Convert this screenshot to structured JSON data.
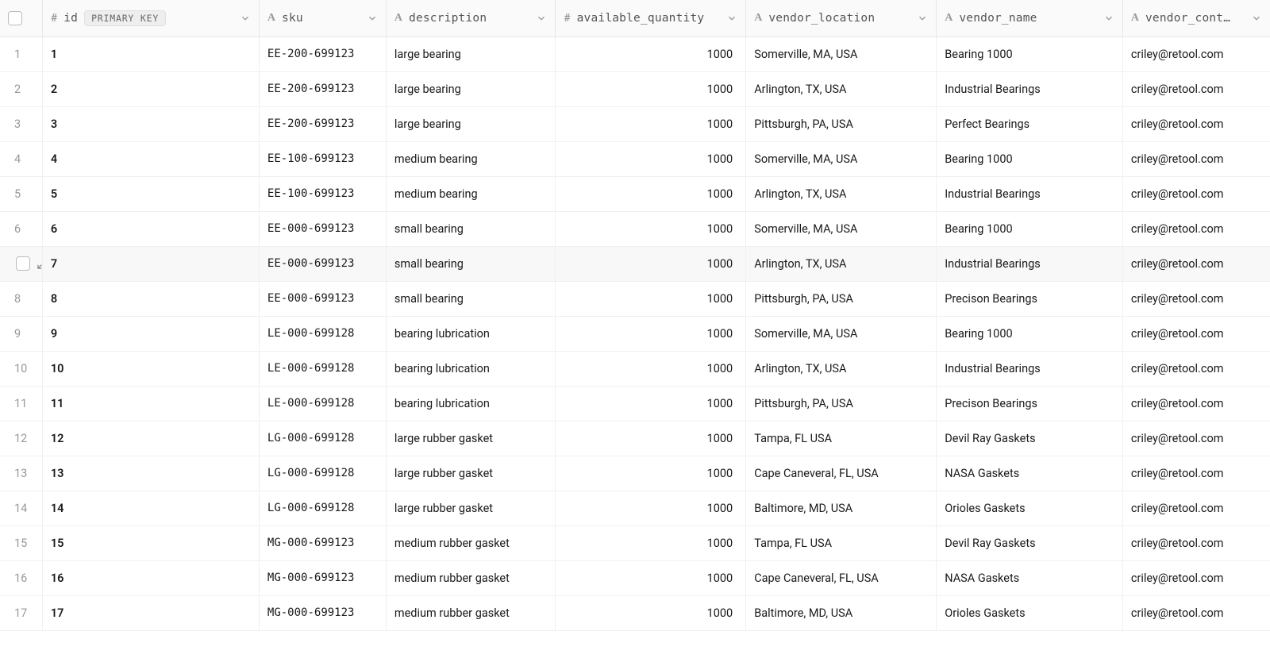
{
  "columns": {
    "id": {
      "label": "id",
      "badge": "PRIMARY KEY",
      "type": "number"
    },
    "sku": {
      "label": "sku",
      "type": "text"
    },
    "description": {
      "label": "description",
      "type": "text"
    },
    "available_quantity": {
      "label": "available_quantity",
      "type": "number"
    },
    "vendor_location": {
      "label": "vendor_location",
      "type": "text"
    },
    "vendor_name": {
      "label": "vendor_name",
      "type": "text"
    },
    "vendor_contact": {
      "label": "vendor_cont…",
      "type": "text"
    }
  },
  "hovered_row_index": 6,
  "rows": [
    {
      "rownum": "1",
      "id": "1",
      "sku": "EE-200-699123",
      "description": "large bearing",
      "available_quantity": "1000",
      "vendor_location": "Somerville, MA, USA",
      "vendor_name": "Bearing 1000",
      "vendor_contact": "criley@retool.com"
    },
    {
      "rownum": "2",
      "id": "2",
      "sku": "EE-200-699123",
      "description": "large bearing",
      "available_quantity": "1000",
      "vendor_location": "Arlington, TX, USA",
      "vendor_name": "Industrial Bearings",
      "vendor_contact": "criley@retool.com"
    },
    {
      "rownum": "3",
      "id": "3",
      "sku": "EE-200-699123",
      "description": "large bearing",
      "available_quantity": "1000",
      "vendor_location": "Pittsburgh, PA, USA",
      "vendor_name": "Perfect Bearings",
      "vendor_contact": "criley@retool.com"
    },
    {
      "rownum": "4",
      "id": "4",
      "sku": "EE-100-699123",
      "description": "medium bearing",
      "available_quantity": "1000",
      "vendor_location": "Somerville, MA, USA",
      "vendor_name": "Bearing 1000",
      "vendor_contact": "criley@retool.com"
    },
    {
      "rownum": "5",
      "id": "5",
      "sku": "EE-100-699123",
      "description": "medium bearing",
      "available_quantity": "1000",
      "vendor_location": "Arlington, TX, USA",
      "vendor_name": "Industrial Bearings",
      "vendor_contact": "criley@retool.com"
    },
    {
      "rownum": "6",
      "id": "6",
      "sku": "EE-000-699123",
      "description": "small bearing",
      "available_quantity": "1000",
      "vendor_location": "Somerville, MA, USA",
      "vendor_name": "Bearing 1000",
      "vendor_contact": "criley@retool.com"
    },
    {
      "rownum": "7",
      "id": "7",
      "sku": "EE-000-699123",
      "description": "small bearing",
      "available_quantity": "1000",
      "vendor_location": "Arlington, TX, USA",
      "vendor_name": "Industrial Bearings",
      "vendor_contact": "criley@retool.com"
    },
    {
      "rownum": "8",
      "id": "8",
      "sku": "EE-000-699123",
      "description": "small bearing",
      "available_quantity": "1000",
      "vendor_location": "Pittsburgh, PA, USA",
      "vendor_name": "Precison Bearings",
      "vendor_contact": "criley@retool.com"
    },
    {
      "rownum": "9",
      "id": "9",
      "sku": "LE-000-699128",
      "description": "bearing lubrication",
      "available_quantity": "1000",
      "vendor_location": "Somerville, MA, USA",
      "vendor_name": "Bearing 1000",
      "vendor_contact": "criley@retool.com"
    },
    {
      "rownum": "10",
      "id": "10",
      "sku": "LE-000-699128",
      "description": "bearing lubrication",
      "available_quantity": "1000",
      "vendor_location": "Arlington, TX, USA",
      "vendor_name": "Industrial Bearings",
      "vendor_contact": "criley@retool.com"
    },
    {
      "rownum": "11",
      "id": "11",
      "sku": "LE-000-699128",
      "description": "bearing lubrication",
      "available_quantity": "1000",
      "vendor_location": "Pittsburgh, PA, USA",
      "vendor_name": "Precison Bearings",
      "vendor_contact": "criley@retool.com"
    },
    {
      "rownum": "12",
      "id": "12",
      "sku": "LG-000-699128",
      "description": "large rubber gasket",
      "available_quantity": "1000",
      "vendor_location": "Tampa, FL USA",
      "vendor_name": "Devil Ray Gaskets",
      "vendor_contact": "criley@retool.com"
    },
    {
      "rownum": "13",
      "id": "13",
      "sku": "LG-000-699128",
      "description": "large rubber gasket",
      "available_quantity": "1000",
      "vendor_location": "Cape Caneveral, FL, USA",
      "vendor_name": "NASA Gaskets",
      "vendor_contact": "criley@retool.com"
    },
    {
      "rownum": "14",
      "id": "14",
      "sku": "LG-000-699128",
      "description": "large rubber gasket",
      "available_quantity": "1000",
      "vendor_location": "Baltimore, MD, USA",
      "vendor_name": "Orioles Gaskets",
      "vendor_contact": "criley@retool.com"
    },
    {
      "rownum": "15",
      "id": "15",
      "sku": "MG-000-699123",
      "description": "medium rubber gasket",
      "available_quantity": "1000",
      "vendor_location": "Tampa, FL USA",
      "vendor_name": "Devil Ray Gaskets",
      "vendor_contact": "criley@retool.com"
    },
    {
      "rownum": "16",
      "id": "16",
      "sku": "MG-000-699123",
      "description": "medium rubber gasket",
      "available_quantity": "1000",
      "vendor_location": "Cape Caneveral, FL, USA",
      "vendor_name": "NASA Gaskets",
      "vendor_contact": "criley@retool.com"
    },
    {
      "rownum": "17",
      "id": "17",
      "sku": "MG-000-699123",
      "description": "medium rubber gasket",
      "available_quantity": "1000",
      "vendor_location": "Baltimore, MD, USA",
      "vendor_name": "Orioles Gaskets",
      "vendor_contact": "criley@retool.com"
    }
  ]
}
